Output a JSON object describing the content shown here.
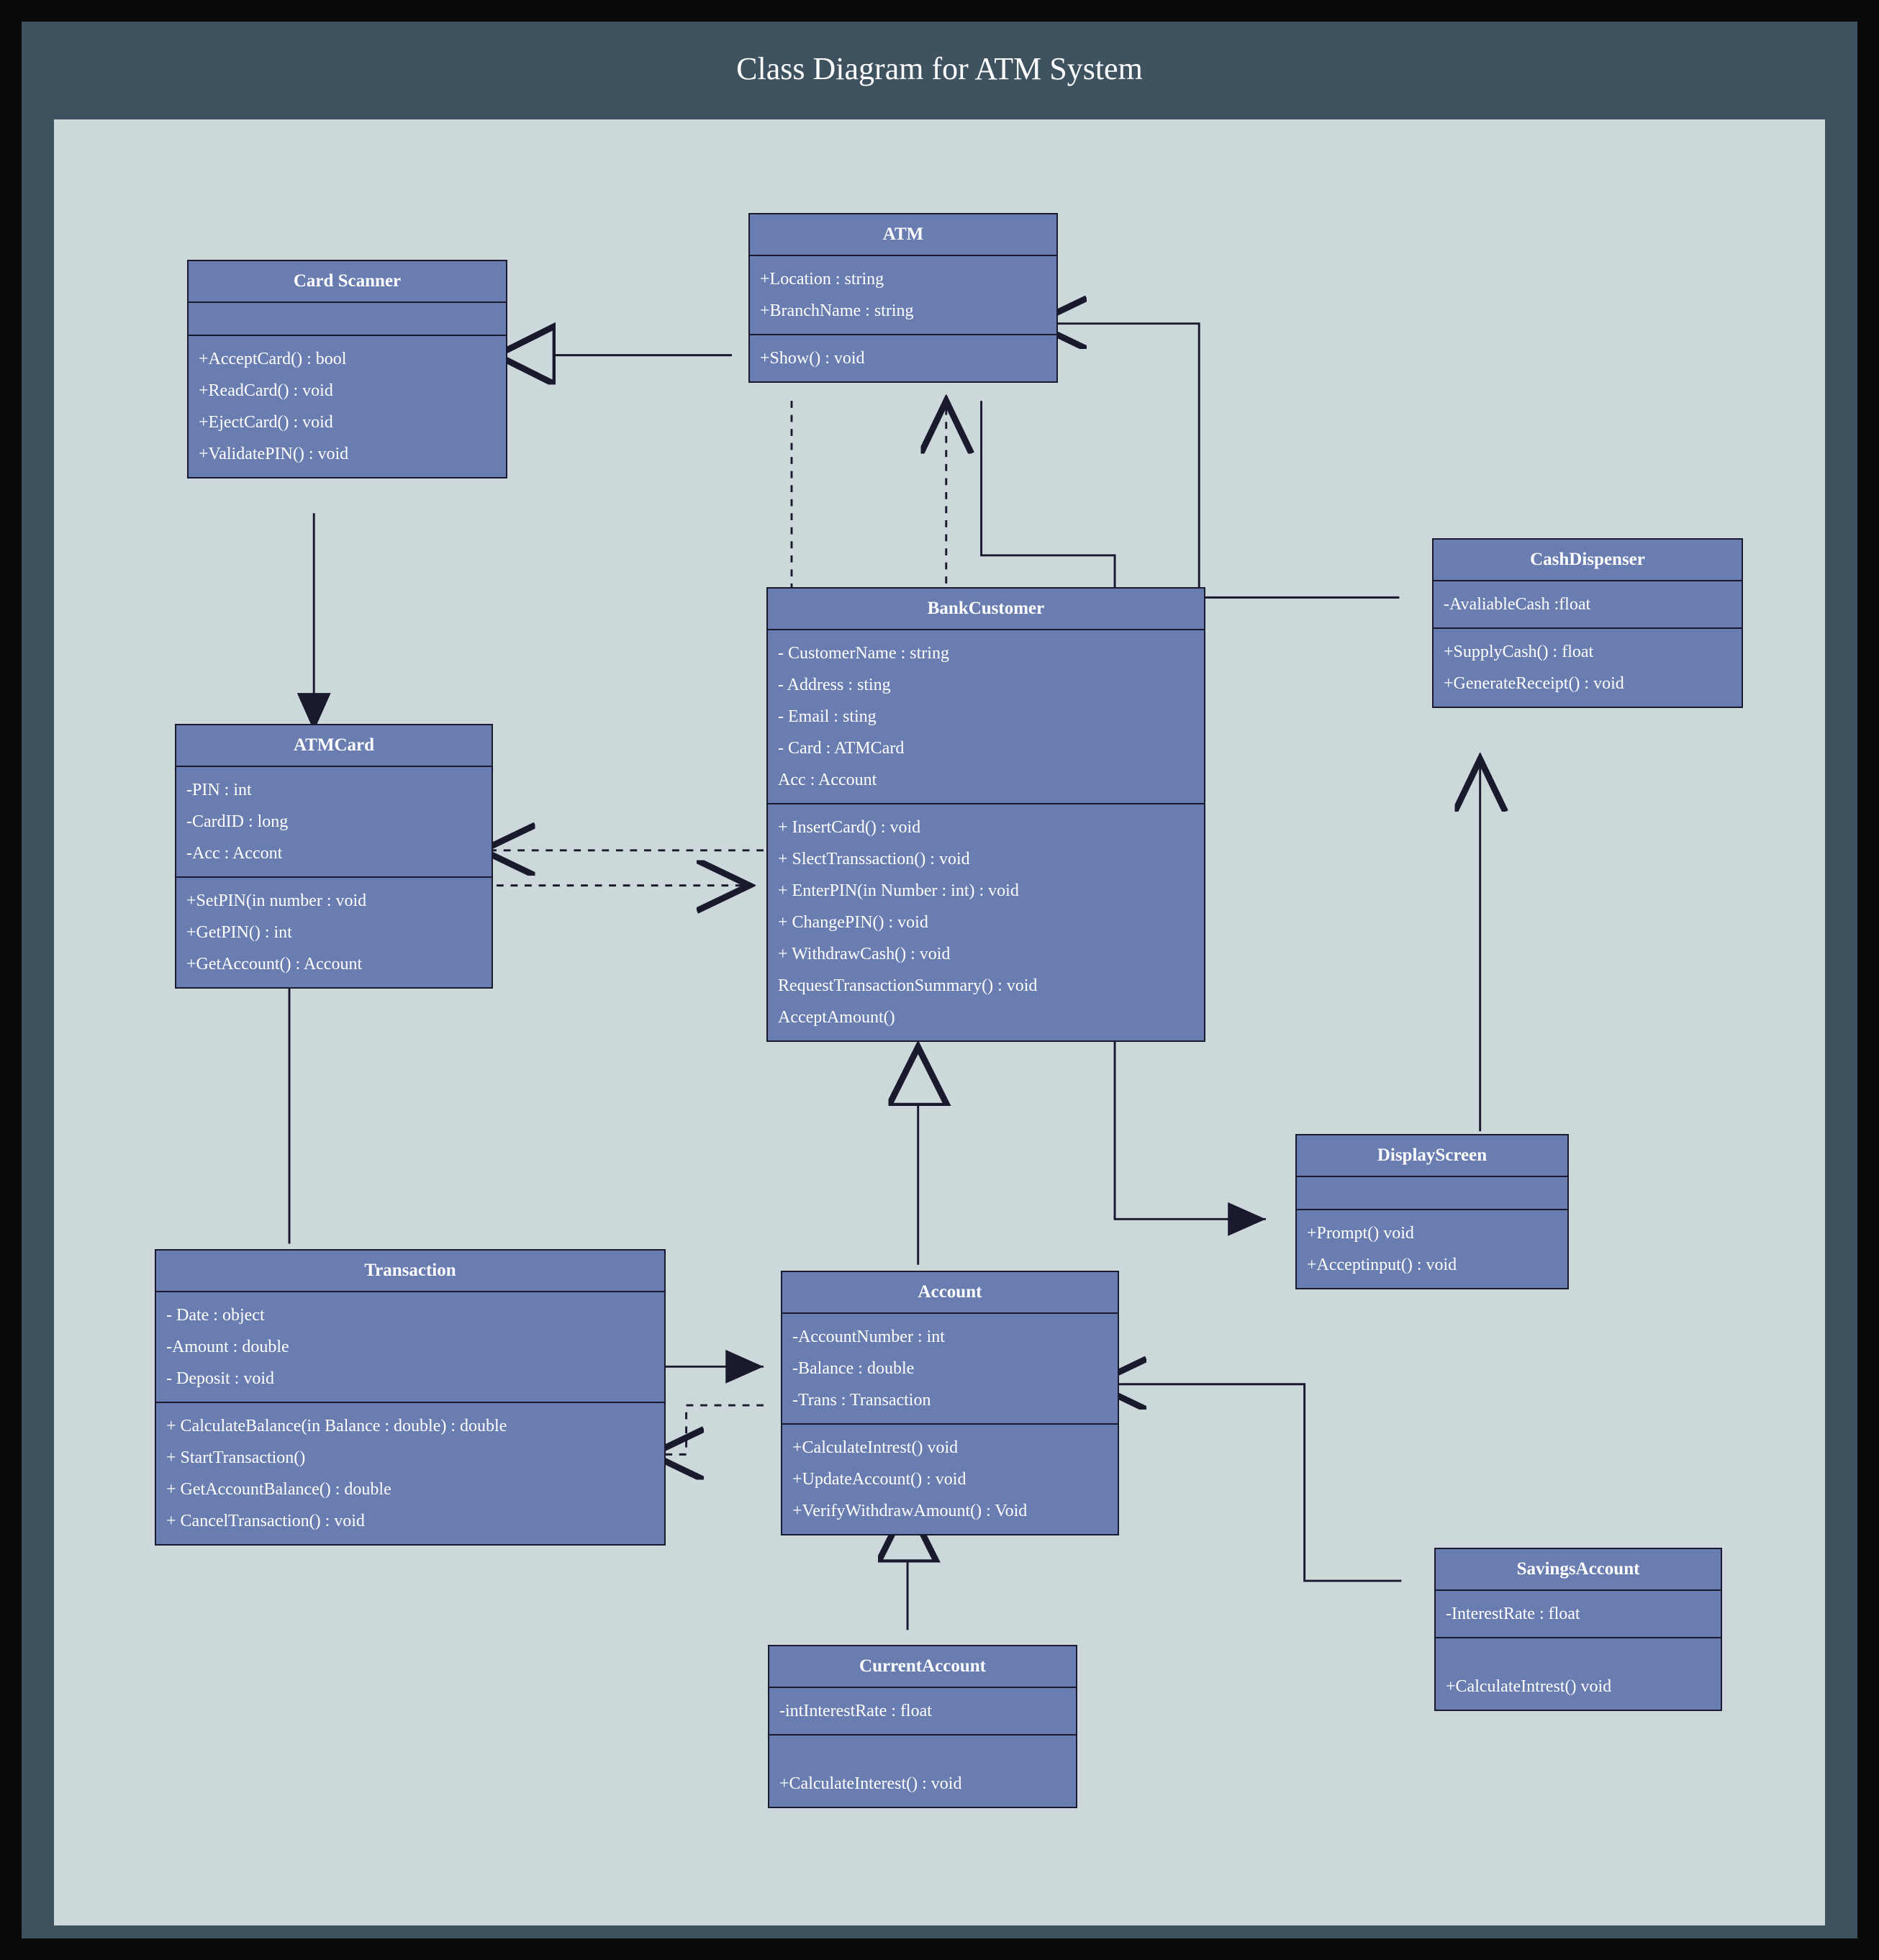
{
  "title": "Class Diagram for ATM System",
  "classes": {
    "card_scanner": {
      "name": "Card Scanner",
      "attrs": [],
      "ops": [
        "+AcceptCard() : bool",
        "+ReadCard() : void",
        "+EjectCard() : void",
        "+ValidatePIN() : void"
      ]
    },
    "atm": {
      "name": "ATM",
      "attrs": [
        "+Location : string",
        "+BranchName : string"
      ],
      "ops": [
        "+Show() : void"
      ]
    },
    "cash_dispenser": {
      "name": "CashDispenser",
      "attrs": [
        "-AvaliableCash :float"
      ],
      "ops": [
        "+SupplyCash() : float",
        "+GenerateReceipt() : void"
      ]
    },
    "atm_card": {
      "name": "ATMCard",
      "attrs": [
        "-PIN : int",
        "-CardID : long",
        "-Acc : Accont"
      ],
      "ops": [
        "+SetPIN(in number : void",
        "+GetPIN() : int",
        "+GetAccount() : Account"
      ]
    },
    "bank_customer": {
      "name": "BankCustomer",
      "attrs": [
        "- CustomerName : string",
        "- Address : sting",
        "- Email : sting",
        "- Card : ATMCard",
        "Acc : Account"
      ],
      "ops": [
        "+ InsertCard() : void",
        "+ SlectTranssaction() : void",
        "+ EnterPIN(in Number : int) : void",
        "+ ChangePIN() : void",
        "+ WithdrawCash() : void",
        "RequestTransactionSummary() : void",
        "AcceptAmount()"
      ]
    },
    "display_screen": {
      "name": "DisplayScreen",
      "attrs": [],
      "ops": [
        "+Prompt() void",
        "+Acceptinput() : void"
      ]
    },
    "transaction": {
      "name": "Transaction",
      "attrs": [
        "- Date : object",
        "-Amount : double",
        "- Deposit : void"
      ],
      "ops": [
        "+ CalculateBalance(in Balance : double) : double",
        "+ StartTransaction()",
        "+ GetAccountBalance() : double",
        "+ CancelTransaction() : void"
      ]
    },
    "account": {
      "name": "Account",
      "attrs": [
        "-AccountNumber : int",
        "-Balance : double",
        "-Trans : Transaction"
      ],
      "ops": [
        "+CalculateIntrest() void",
        "+UpdateAccount() : void",
        "+VerifyWithdrawAmount() :  Void"
      ]
    },
    "current_account": {
      "name": "CurrentAccount",
      "attrs": [
        "-intInterestRate : float"
      ],
      "ops": [
        "+CalculateInterest() : void"
      ]
    },
    "savings_account": {
      "name": "SavingsAccount",
      "attrs": [
        "-InterestRate : float"
      ],
      "ops": [
        "+CalculateIntrest() void"
      ]
    }
  }
}
